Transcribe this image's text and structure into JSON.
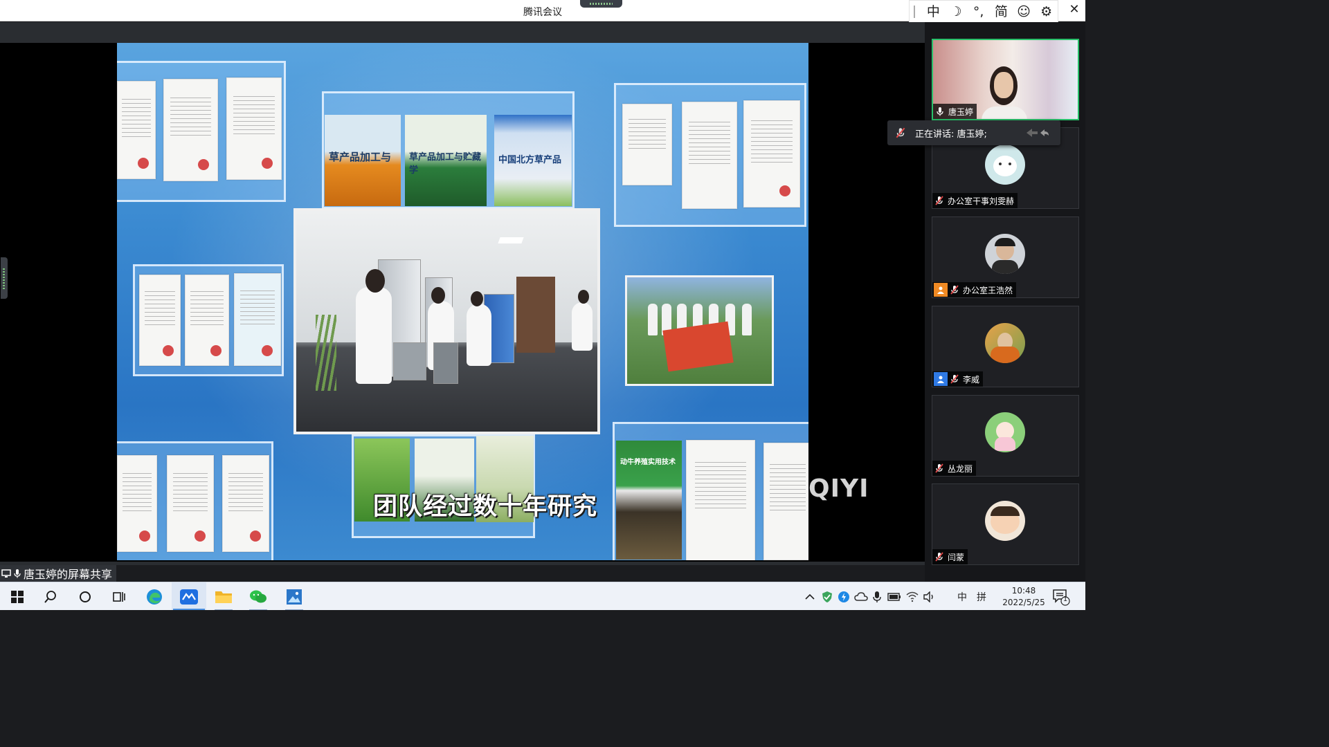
{
  "window": {
    "title": "腾讯会议",
    "close_glyph": "✕"
  },
  "ime_bar": {
    "items": [
      "中",
      "☽",
      "°,",
      "简",
      "☺",
      "⚙"
    ]
  },
  "share": {
    "label": "唐玉婷的屏幕共享",
    "video": {
      "subtitle": "团队经过数十年研究",
      "watermark": "QIYI",
      "book_titles": [
        "草产品加工与",
        "草产品加工与贮藏学",
        "中国北方草产品",
        "动牛养殖实用技术"
      ]
    }
  },
  "participants": [
    {
      "name": "唐玉婷",
      "muted": false,
      "active": true,
      "role": ""
    },
    {
      "name": "办公室干事刘雯赫",
      "muted": true,
      "active": false,
      "role": ""
    },
    {
      "name": "办公室王浩然",
      "muted": true,
      "active": false,
      "role": "host"
    },
    {
      "name": "李威",
      "muted": true,
      "active": false,
      "role": "cohost"
    },
    {
      "name": "丛龙丽",
      "muted": true,
      "active": false,
      "role": ""
    },
    {
      "name": "闫蒙",
      "muted": true,
      "active": false,
      "role": ""
    }
  ],
  "speaking": {
    "text": "正在讲话: 唐玉婷;"
  },
  "taskbar": {
    "ime_mode": "中",
    "ime_layout": "拼",
    "time": "10:48",
    "date": "2022/5/25",
    "notification_count": "1"
  },
  "colors": {
    "active_border": "#29c16b",
    "muted_mic": "#e04a4a",
    "host_badge": "#f08a24",
    "cohost_badge": "#2f7ae5"
  }
}
